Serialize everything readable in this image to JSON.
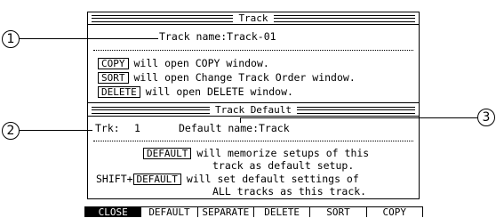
{
  "track_section": {
    "title": "Track",
    "track_name_label": "Track name:Track-01",
    "copy_button": "COPY",
    "copy_desc": "will open COPY window.",
    "sort_button": "SORT",
    "sort_desc": "will open Change Track Order window.",
    "delete_button": "DELETE",
    "delete_desc": "will open DELETE window."
  },
  "default_section": {
    "title": "Track Default",
    "trk_label": "Trk:",
    "trk_value": "1",
    "default_name_label": "Default name:Track",
    "default_button": "DEFAULT",
    "default_desc_line1": "will memorize setups of this",
    "default_desc_line2": "track as default setup.",
    "shift_prefix": "SHIFT+",
    "shift_default_button": "DEFAULT",
    "shift_desc_line1": "will set default settings of",
    "shift_desc_line2": "ALL tracks as this track."
  },
  "callouts": [
    "1",
    "2",
    "3"
  ],
  "function_bar": {
    "active": "CLOSE",
    "buttons": [
      "CLOSE",
      "DEFAULT",
      "SEPARATE",
      "DELETE",
      "SORT",
      "COPY"
    ]
  }
}
